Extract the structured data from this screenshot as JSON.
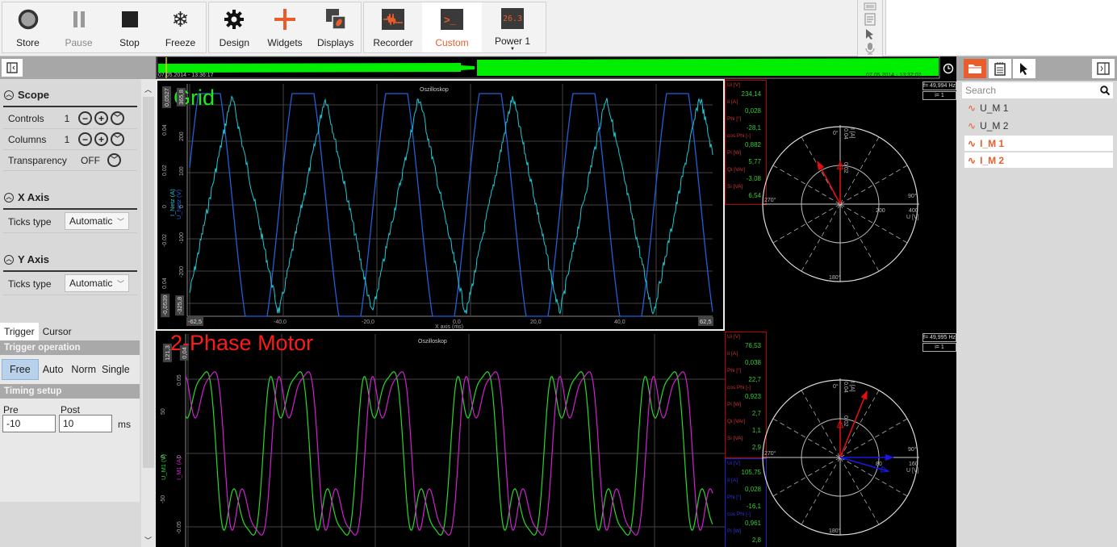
{
  "toolbar": {
    "groups": [
      [
        {
          "label": "Store",
          "icon": "record-circle-icon"
        },
        {
          "label": "Pause",
          "icon": "pause-icon",
          "disabled": true
        },
        {
          "label": "Stop",
          "icon": "stop-icon"
        },
        {
          "label": "Freeze",
          "icon": "snowflake-icon"
        }
      ],
      [
        {
          "label": "Design",
          "icon": "gear-icon"
        },
        {
          "label": "Widgets",
          "icon": "plus-icon"
        },
        {
          "label": "Displays",
          "icon": "displays-icon"
        }
      ],
      [
        {
          "label": "Recorder",
          "icon": "waveform-icon"
        },
        {
          "label": "Custom",
          "icon": "terminal-icon",
          "active": true
        },
        {
          "label": "Power 1",
          "icon": "digital-display-icon",
          "icon_text": "26.3",
          "has_dropdown": true
        }
      ]
    ],
    "accent": "#e85d2a"
  },
  "left_panel": {
    "scope": {
      "title": "Scope",
      "controls_label": "Controls",
      "controls_value": "1",
      "columns_label": "Columns",
      "columns_value": "1",
      "transparency_label": "Transparency",
      "transparency_value": "OFF"
    },
    "x_axis": {
      "title": "X Axis",
      "ticks_label": "Ticks type",
      "ticks_value": "Automatic"
    },
    "y_axis": {
      "title": "Y Axis",
      "ticks_label": "Ticks type",
      "ticks_value": "Automatic"
    },
    "tabs": [
      "Trigger",
      "Cursor"
    ],
    "trigger": {
      "operation_title": "Trigger operation",
      "modes": [
        "Free",
        "Auto",
        "Norm",
        "Single"
      ],
      "active_mode": "Free",
      "timing_title": "Timing setup",
      "pre_label": "Pre",
      "pre_value": "-10",
      "post_label": "Post",
      "post_value": "10",
      "unit": "ms"
    }
  },
  "overview": {
    "start_time": "07.05.2014 - 13:36:17",
    "end_time": "07.05.2014 - 13:37:02"
  },
  "scopes": [
    {
      "title": "Grid",
      "title_color": "#22e822",
      "subtitle": "Oszilloskop",
      "y1_label": "I_Netz (A)",
      "y2_label": "U_Netz (V)",
      "y1_ticks": [
        "0.04",
        "0.02",
        "0",
        "-0.02",
        "0.04"
      ],
      "y2_ticks": [
        "200",
        "100",
        "0",
        "-100",
        "-200"
      ],
      "y1_max": "0,0527",
      "y1_min": "-0,0539",
      "y2_max": "365,8",
      "y2_min": "-325,8",
      "x_ticks": [
        "-40,0",
        "-20,0",
        "0,0",
        "20,0",
        "40,0"
      ],
      "x_min": "-62,5",
      "x_max": "62,5",
      "x_label": "X axis (ms)",
      "colors": {
        "current": "#1ec8d6",
        "voltage": "#2060d8"
      }
    },
    {
      "title": "2-Phase Motor",
      "title_color": "#ff1a1a",
      "subtitle": "Oszilloskop",
      "y1_label": "U_M1 (V)",
      "y2_label": "I_M1 (A)",
      "y1_ticks": [
        "50",
        "0",
        "-50"
      ],
      "y2_ticks": [
        "0.05",
        "0",
        "-0.05"
      ],
      "y1_max": "121,3",
      "y2_max": "0,04",
      "colors": {
        "voltage": "#28d828",
        "current": "#d020d0"
      }
    }
  ],
  "phasors": [
    {
      "frequency": "f= 49,994 Hz",
      "harmonic": "i= 1",
      "measurements": [
        {
          "k": "Ui [V]",
          "v": "234,14"
        },
        {
          "k": "Ii [A]",
          "v": "0,028"
        },
        {
          "k": "Phi [°]",
          "v": "-28,1"
        },
        {
          "k": "cos Phi [-]",
          "v": "0,882"
        },
        {
          "k": "Pi [W]",
          "v": "5,77"
        },
        {
          "k": "Qi [VAr]",
          "v": "-3,08"
        },
        {
          "k": "Si [VA]",
          "v": "6,54"
        }
      ],
      "labels": {
        "deg0": "0°",
        "deg90": "90°",
        "deg180": "180°",
        "deg270": "270°",
        "u_inner": "200",
        "u_outer": "400",
        "u_unit": "U [V]",
        "i_inner": "0.02",
        "i_outer": "0.04",
        "i_unit": "I [A]"
      }
    },
    {
      "frequency": "f= 49,995 Hz",
      "harmonic": "i= 1",
      "measurements": [
        {
          "k": "Ui [V]",
          "v": "76,53"
        },
        {
          "k": "Ii [A]",
          "v": "0,038"
        },
        {
          "k": "Phi [°]",
          "v": "22,7"
        },
        {
          "k": "cos Phi [-]",
          "v": "0,923"
        },
        {
          "k": "Pi [W]",
          "v": "2,7"
        },
        {
          "k": "Qi [VAr]",
          "v": "1,1"
        },
        {
          "k": "Si [VA]",
          "v": "2,9"
        }
      ],
      "measurements2": [
        {
          "k": "Ui [V]",
          "v": "105,75"
        },
        {
          "k": "Ii [A]",
          "v": "0,028"
        },
        {
          "k": "Phi [°]",
          "v": "-16,1"
        },
        {
          "k": "cos Phi [-]",
          "v": "0,961"
        },
        {
          "k": "Pi [W]",
          "v": "2,8"
        }
      ],
      "labels": {
        "deg0": "0°",
        "deg90": "90°",
        "deg180": "180°",
        "deg270": "270°",
        "u_inner": "80",
        "u_outer": "160",
        "u_unit": "U [V]",
        "i_inner": "0.02",
        "i_outer": "0.04",
        "i_unit": "I [A]"
      }
    }
  ],
  "right_panel": {
    "search_placeholder": "Search",
    "channels": [
      {
        "name": "U_M 1",
        "selected": false
      },
      {
        "name": "U_M 2",
        "selected": false
      },
      {
        "name": "I_M 1",
        "selected": true
      },
      {
        "name": "I_M 2",
        "selected": true
      }
    ]
  }
}
